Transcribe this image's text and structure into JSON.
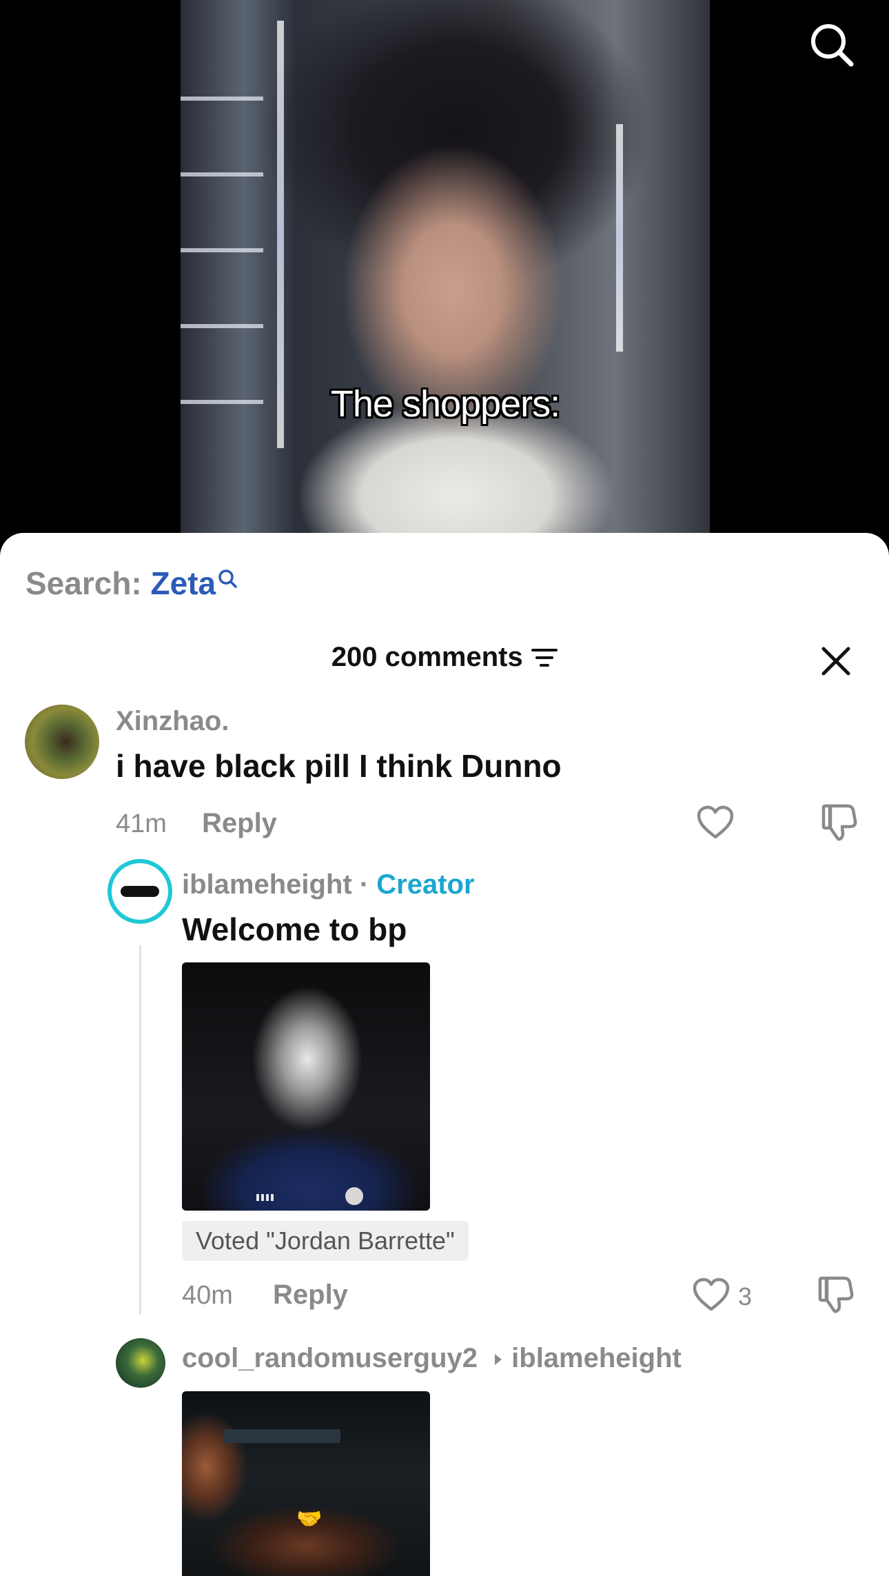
{
  "video": {
    "caption": "The shoppers:"
  },
  "sheet": {
    "search": {
      "label": "Search:",
      "term": "Zeta"
    },
    "comments_count": "200 comments"
  },
  "comments": [
    {
      "username": "Xinzhao.",
      "text": "i have black pill I think Dunno",
      "time": "41m",
      "reply_label": "Reply",
      "likes": ""
    },
    {
      "username": "iblameheight",
      "separator": " · ",
      "badge": "Creator",
      "text": "Welcome to bp",
      "voted": "Voted \"Jordan Barrette\"",
      "time": "40m",
      "reply_label": "Reply",
      "likes": "3"
    },
    {
      "username": "cool_randomuserguy2",
      "reply_to": "iblameheight"
    }
  ],
  "icons": {
    "search": "search-icon",
    "filter": "filter-icon",
    "close": "close-icon",
    "like": "heart-icon",
    "dislike": "thumbs-down-icon"
  },
  "colors": {
    "search_term": "#2b5bb7",
    "creator_badge": "#1aa6d0",
    "muted_text": "#8a8a8a"
  }
}
